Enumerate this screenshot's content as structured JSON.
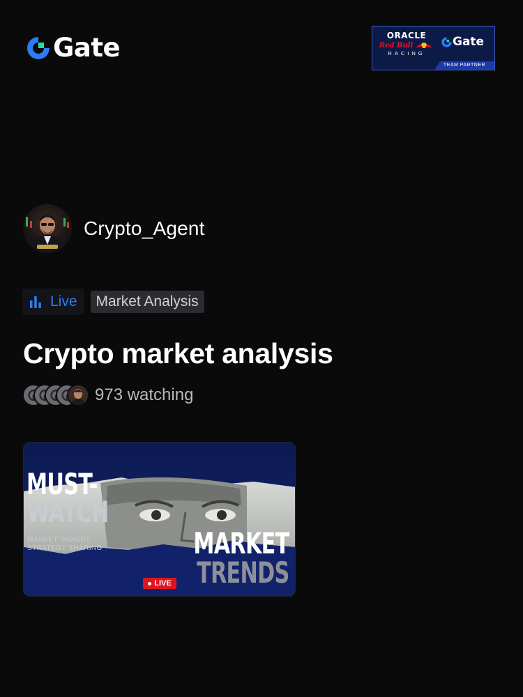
{
  "brand": {
    "name": "Gate",
    "accent": "#2e7bf6",
    "mark_green": "#17e3a8"
  },
  "partner_badge": {
    "line1": "ORACLE",
    "line2": "Red Bull",
    "line3": "RACING",
    "brand": "Gate",
    "footer": "TEAM PARTNER"
  },
  "host": {
    "name": "Crypto_Agent"
  },
  "tags": {
    "live": "Live",
    "category": "Market Analysis"
  },
  "title": "Crypto market analysis",
  "watching": {
    "text": "973 watching"
  },
  "thumbnail": {
    "headline_1": "MUST-",
    "headline_2": "WATCH",
    "sub_1": "MARKET INSIGHT",
    "sub_2": "STRATEGY SHARING",
    "trend_1": "MARKET",
    "trend_2": "TRENDS",
    "live_badge": "LIVE"
  }
}
